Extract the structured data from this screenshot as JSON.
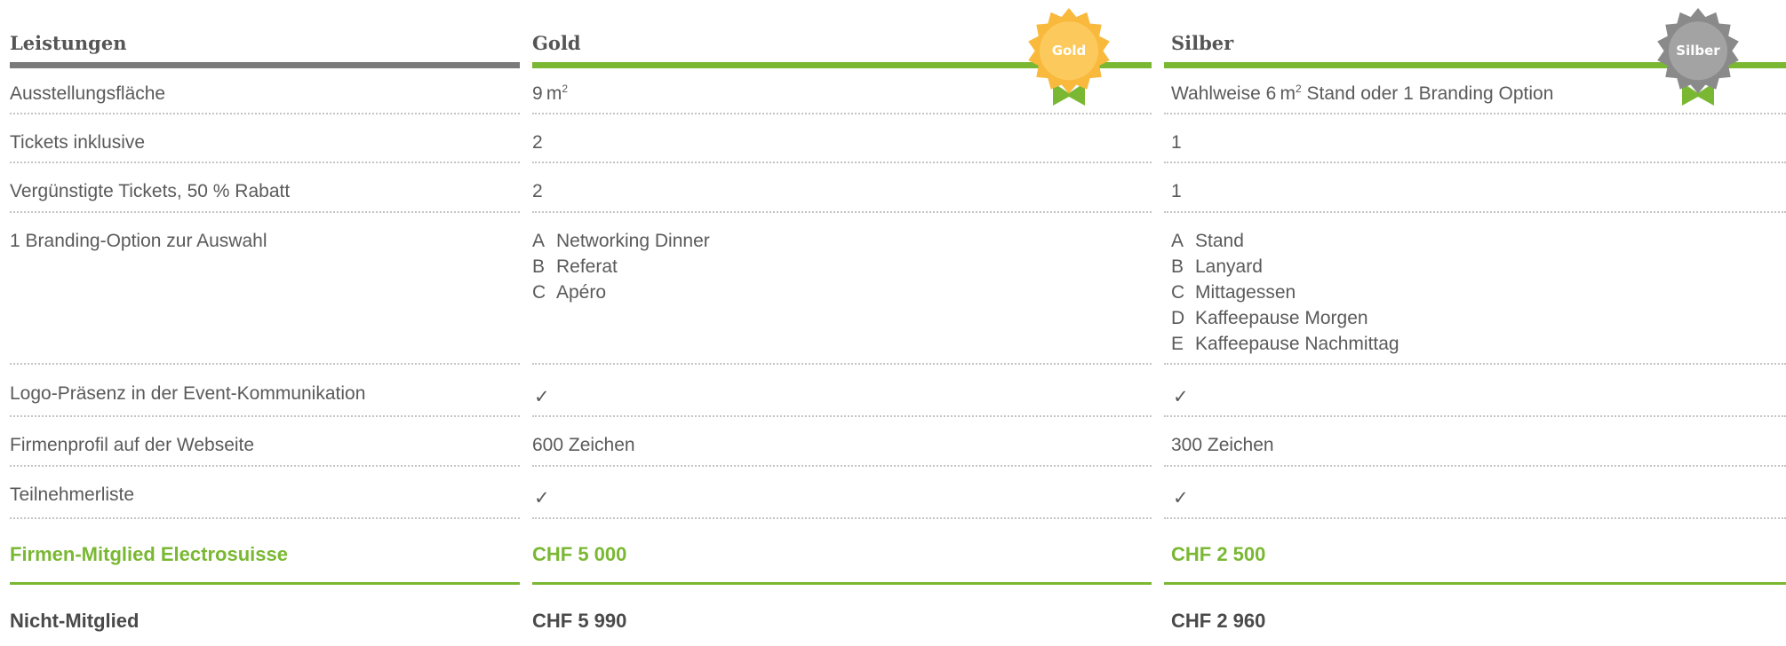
{
  "headers": {
    "leistungen": "Leistungen",
    "gold": "Gold",
    "silber": "Silber"
  },
  "badges": {
    "gold": "Gold",
    "silber": "Silber"
  },
  "colors": {
    "accent_green": "#7ab833",
    "gold": "#f9b93d",
    "silver": "#8a8a8a",
    "text": "#5a5a5a"
  },
  "rows": {
    "ausstellungsflaeche": {
      "label": "Ausstellungsfläche",
      "gold_value": "9",
      "gold_unit": "m",
      "gold_exp": "2",
      "silber_pre": "Wahlweise 6",
      "silber_unit": "m",
      "silber_exp": "2",
      "silber_post": " Stand oder 1 Branding Option"
    },
    "tickets": {
      "label": "Tickets inklusive",
      "gold": "2",
      "silber": "1"
    },
    "verguenstigt": {
      "label": "Vergünstigte Tickets, 50 % Rabatt",
      "gold": "2",
      "silber": "1"
    },
    "branding": {
      "label": "1 Branding-Option zur Auswahl",
      "gold": [
        {
          "letter": "A",
          "text": "Networking Dinner"
        },
        {
          "letter": "B",
          "text": "Referat"
        },
        {
          "letter": "C",
          "text": "Apéro"
        }
      ],
      "silber": [
        {
          "letter": "A",
          "text": "Stand"
        },
        {
          "letter": "B",
          "text": "Lanyard"
        },
        {
          "letter": "C",
          "text": "Mittagessen"
        },
        {
          "letter": "D",
          "text": "Kaffeepause Morgen"
        },
        {
          "letter": "E",
          "text": "Kaffeepause Nachmittag"
        }
      ]
    },
    "logo": {
      "label": "Logo-Präsenz in der Event-Kommunikation",
      "gold": "✓",
      "silber": "✓"
    },
    "firmenprofil": {
      "label": "Firmenprofil auf der Webseite",
      "gold": "600 Zeichen",
      "silber": "300 Zeichen"
    },
    "teilnehmer": {
      "label": "Teilnehmerliste",
      "gold": "✓",
      "silber": "✓"
    }
  },
  "pricing": {
    "member": {
      "label": "Firmen-Mitglied Electrosuisse",
      "gold": "CHF 5 000",
      "silber": "CHF 2 500"
    },
    "nonmember": {
      "label": "Nicht-Mitglied",
      "gold": "CHF 5 990",
      "silber": "CHF 2 960"
    }
  }
}
